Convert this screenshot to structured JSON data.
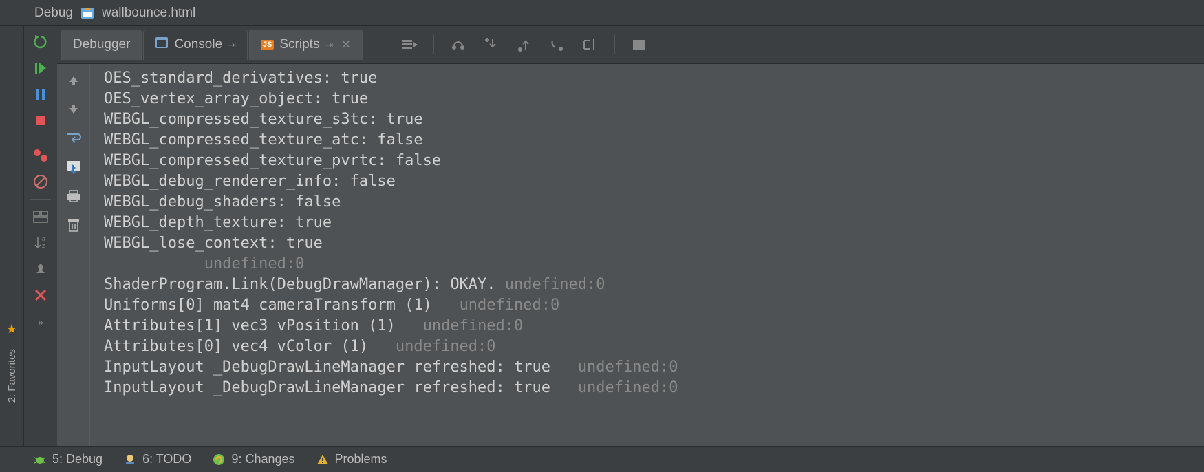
{
  "header": {
    "title": "Debug",
    "filename": "wallbounce.html"
  },
  "leftbar": {
    "favorites_label": "2: Favorites"
  },
  "tabs": {
    "debugger": "Debugger",
    "console": "Console",
    "scripts": "Scripts"
  },
  "console_lines": [
    {
      "text": "OES_standard_derivatives: true",
      "suffix": ""
    },
    {
      "text": "OES_vertex_array_object: true",
      "suffix": ""
    },
    {
      "text": "WEBGL_compressed_texture_s3tc: true",
      "suffix": ""
    },
    {
      "text": "WEBGL_compressed_texture_atc: false",
      "suffix": ""
    },
    {
      "text": "WEBGL_compressed_texture_pvrtc: false",
      "suffix": ""
    },
    {
      "text": "WEBGL_debug_renderer_info: false",
      "suffix": ""
    },
    {
      "text": "WEBGL_debug_shaders: false",
      "suffix": ""
    },
    {
      "text": "WEBGL_depth_texture: true",
      "suffix": ""
    },
    {
      "text": "WEBGL_lose_context: true",
      "suffix": ""
    },
    {
      "text": "           ",
      "suffix": "undefined:0"
    },
    {
      "text": "ShaderProgram.Link(DebugDrawManager): OKAY. ",
      "suffix": "undefined:0"
    },
    {
      "text": "Uniforms[0] mat4 cameraTransform (1)   ",
      "suffix": "undefined:0"
    },
    {
      "text": "Attributes[1] vec3 vPosition (1)   ",
      "suffix": "undefined:0"
    },
    {
      "text": "Attributes[0] vec4 vColor (1)   ",
      "suffix": "undefined:0"
    },
    {
      "text": "InputLayout _DebugDrawLineManager refreshed: true   ",
      "suffix": "undefined:0"
    },
    {
      "text": "InputLayout _DebugDrawLineManager refreshed: true   ",
      "suffix": "undefined:0"
    }
  ],
  "statusbar": {
    "debug": {
      "key": "5",
      "label": ": Debug"
    },
    "todo": {
      "key": "6",
      "label": ": TODO"
    },
    "changes": {
      "key": "9",
      "label": ": Changes"
    },
    "problems": "Problems"
  }
}
